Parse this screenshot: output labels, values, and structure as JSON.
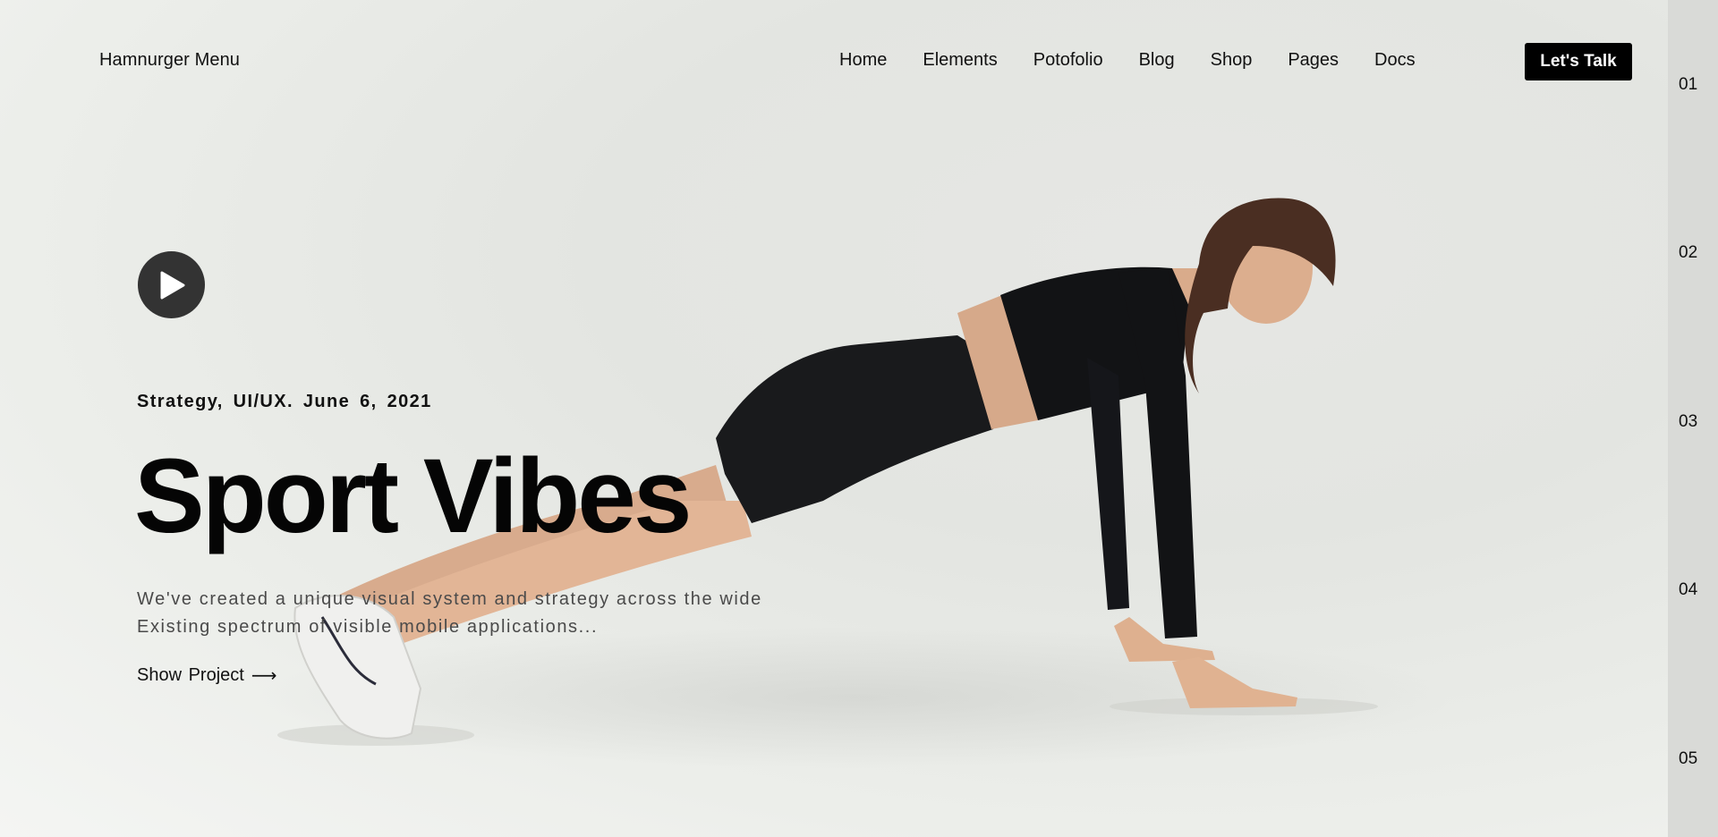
{
  "header": {
    "logo": "Hamnurger Menu",
    "nav": [
      "Home",
      "Elements",
      "Potofolio",
      "Blog",
      "Shop",
      "Pages",
      "Docs"
    ],
    "cta": "Let's Talk"
  },
  "hero": {
    "meta": "Strategy,  UI/UX.  June  6,  2021",
    "title": "Sport Vibes",
    "desc_line1": "We've created a unique visual system and strategy across the wide",
    "desc_line2": "Existing spectrum of visible mobile applications...",
    "show_project": "Show Project",
    "show_project_arrow": "⟶"
  },
  "rail": {
    "items": [
      "01",
      "02",
      "03",
      "04",
      "05"
    ]
  },
  "colors": {
    "accent": "#000000",
    "background": "#eceeea",
    "rail": "#d9dad7"
  }
}
